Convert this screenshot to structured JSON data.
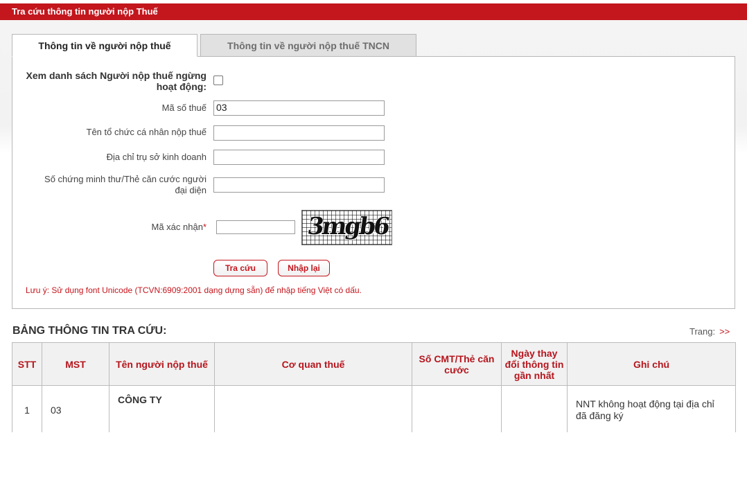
{
  "header": {
    "title": "Tra cứu thông tin người nộp Thuế"
  },
  "tabs": [
    {
      "label": "Thông tin về người nộp thuế",
      "active": true
    },
    {
      "label": "Thông tin về người nộp thuế TNCN",
      "active": false
    }
  ],
  "form": {
    "inactive_list_label_line1": "Xem danh sách Người nộp thuế ngừng",
    "inactive_list_label_line2": "hoạt động:",
    "tax_code_label": "Mã số thuế",
    "tax_code_value": "03",
    "org_name_label": "Tên tổ chức cá nhân nộp thuế",
    "org_name_value": "",
    "address_label": "Địa chỉ trụ sở kinh doanh",
    "address_value": "",
    "id_label_line1": "Số chứng minh thư/Thẻ căn cước người",
    "id_label_line2": "đại diện",
    "id_value": "",
    "captcha_label": "Mã xác nhận",
    "captcha_required_mark": "*",
    "captcha_value": "",
    "captcha_text": "3mgb6"
  },
  "buttons": {
    "search": "Tra cứu",
    "reset": "Nhập lại"
  },
  "note": "Lưu ý: Sử dụng font Unicode (TCVN:6909:2001 dạng dựng sẵn) để nhập tiếng Việt có dấu.",
  "results": {
    "title": "BẢNG THÔNG TIN TRA CỨU:",
    "pager_label": "Trang:",
    "pager_next": ">>",
    "columns": [
      "STT",
      "MST",
      "Tên người nộp thuế",
      "Cơ quan thuế",
      "Số CMT/Thẻ căn cước",
      "Ngày thay đổi thông tin gần nhất",
      "Ghi chú"
    ],
    "rows": [
      {
        "stt": "1",
        "mst": "03",
        "name": "CÔNG TY",
        "agency": "",
        "id_no": "",
        "changed_date": "",
        "note": "NNT không hoạt động tại địa chỉ đã đăng ký"
      }
    ]
  },
  "colors": {
    "accent": "#c3161d",
    "tab_inactive_bg": "#e1e1e1",
    "header_cell_bg": "#f1f1f1"
  }
}
